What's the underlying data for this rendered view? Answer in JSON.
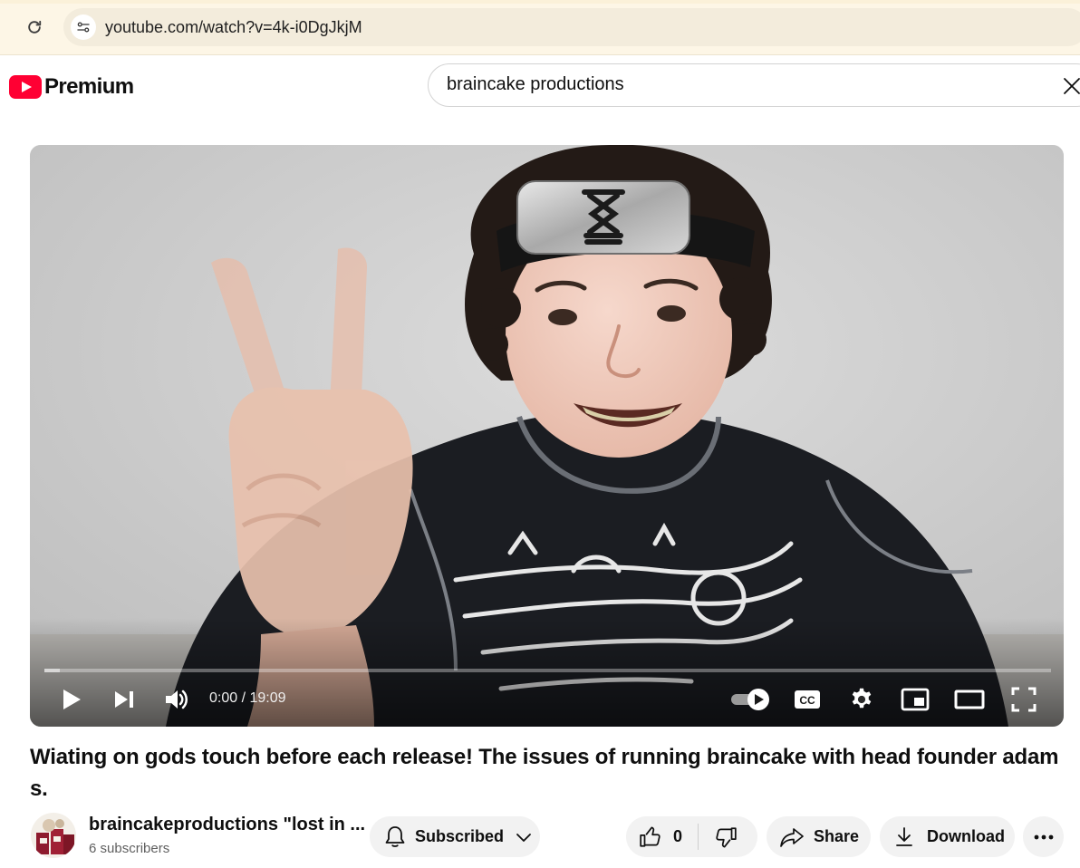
{
  "browser": {
    "url": "youtube.com/watch?v=4k-i0DgJkjM"
  },
  "header": {
    "logo_text": "Premium",
    "search": {
      "value": "braincake productions"
    }
  },
  "player": {
    "time_current": "0:00",
    "time_total": "19:09",
    "time_display": "0:00 / 19:09",
    "progress": 0.0,
    "buffered": 0.015
  },
  "video": {
    "title": "Wiating on gods touch before each release! The issues of running braincake with head founder adam s.",
    "channel_name": "braincakeproductions \"lost in ...",
    "subscribers": "6 subscribers"
  },
  "actions": {
    "subscribe_label": "Subscribed",
    "like_count": "0",
    "share_label": "Share",
    "download_label": "Download"
  },
  "colors": {
    "brand_red": "#ff0033",
    "pill_bg": "#f2f2f2",
    "browser_chrome": "#fdf6e6"
  }
}
